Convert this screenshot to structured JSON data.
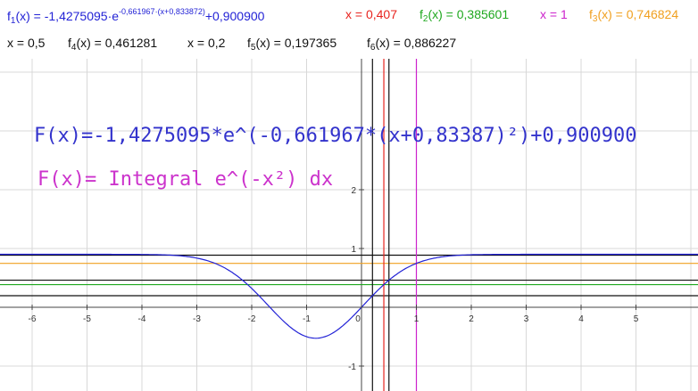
{
  "algebra": {
    "f1": {
      "prefix": "f",
      "index": "1",
      "lhs_open": "(x) = -1,4275095·e",
      "exponent": "-0,661967·(x+0,833872)",
      "tail": "+0,900900",
      "color": "#2323d6"
    },
    "x_red": {
      "text": "x = 0,407",
      "color": "#e8231e"
    },
    "f2": {
      "prefix": "f",
      "index": "2",
      "rest": "(x) = 0,385601",
      "color": "#1fa81f"
    },
    "x_magenta": {
      "text": "x = 1",
      "color": "#cc22cc"
    },
    "f3": {
      "prefix": "f",
      "index": "3",
      "rest": "(x) = 0,746824",
      "color": "#f0a020"
    },
    "x_a": {
      "text": "x = 0,5",
      "color": "#111111"
    },
    "f4": {
      "prefix": "f",
      "index": "4",
      "rest": "(x) = 0,461281",
      "color": "#111111"
    },
    "x_b": {
      "text": "x = 0,2",
      "color": "#111111"
    },
    "f5": {
      "prefix": "f",
      "index": "5",
      "rest": "(x) = 0,197365",
      "color": "#111111"
    },
    "f6": {
      "prefix": "f",
      "index": "6",
      "rest": "(x) = 0,886227",
      "color": "#111111"
    }
  },
  "graph": {
    "text1": "F(x)=-1,4275095*e^(-0,661967*(x+0,83387)²)+0,900900",
    "text1_color": "#3333cc",
    "text2": "F(x)= Integral e^(-x²) dx",
    "text2_color": "#cc33cc",
    "x_ticks": [
      "-6",
      "-5",
      "-4",
      "-3",
      "-2",
      "-1",
      "0",
      "1",
      "2",
      "3",
      "4",
      "5"
    ],
    "y_ticks": [
      "1",
      "2",
      "-1"
    ]
  },
  "chart_data": {
    "type": "line",
    "title": "",
    "xlim": [
      -6.5,
      5.6
    ],
    "ylim": [
      -1.5,
      3.3
    ],
    "grid": true,
    "series": [
      {
        "name": "f1",
        "formula": "-1.4275095*exp(-0.661967*(x+0.833872)^2)+0.9009",
        "color": "#2323d6"
      },
      {
        "name": "f2",
        "y": 0.385601,
        "color": "#1fa81f"
      },
      {
        "name": "f3",
        "y": 0.746824,
        "color": "#f0a020"
      },
      {
        "name": "f4",
        "y": 0.461281,
        "color": "#111111"
      },
      {
        "name": "f5",
        "y": 0.197365,
        "color": "#111111"
      },
      {
        "name": "f6",
        "y": 0.886227,
        "color": "#111111"
      }
    ],
    "vertical_lines": [
      {
        "x": 0.407,
        "color": "#e8231e"
      },
      {
        "x": 1,
        "color": "#cc22cc"
      },
      {
        "x": 0.5,
        "color": "#111111"
      },
      {
        "x": 0.2,
        "color": "#111111"
      }
    ]
  }
}
